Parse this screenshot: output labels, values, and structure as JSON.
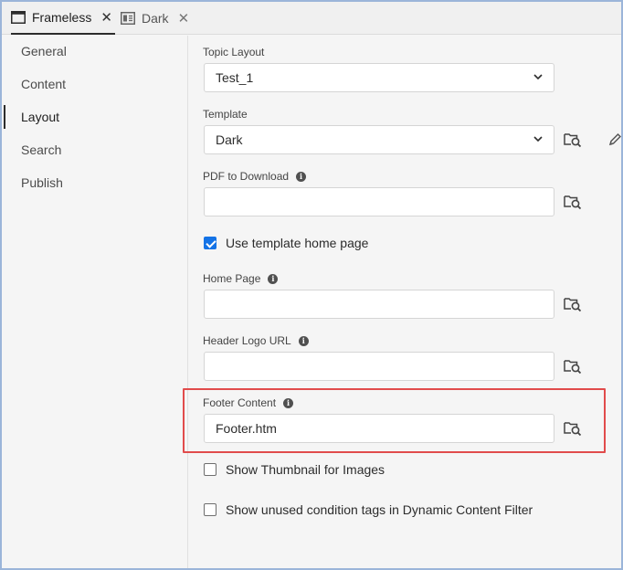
{
  "tabs": [
    {
      "label": "Frameless",
      "icon": "window-icon",
      "close": "✕"
    },
    {
      "label": "Dark",
      "icon": "layout-icon",
      "close": "✕"
    }
  ],
  "sidebar": {
    "items": [
      {
        "label": "General"
      },
      {
        "label": "Content"
      },
      {
        "label": "Layout"
      },
      {
        "label": "Search"
      },
      {
        "label": "Publish"
      }
    ],
    "selected": "Layout"
  },
  "form": {
    "topic_layout": {
      "label": "Topic Layout",
      "value": "Test_1"
    },
    "template": {
      "label": "Template",
      "value": "Dark"
    },
    "pdf_to_download": {
      "label": "PDF to Download",
      "value": ""
    },
    "use_template_home": {
      "label": "Use template home page",
      "checked": true
    },
    "home_page": {
      "label": "Home Page",
      "value": ""
    },
    "header_logo_url": {
      "label": "Header Logo URL",
      "value": ""
    },
    "footer_content": {
      "label": "Footer Content",
      "value": "Footer.htm"
    },
    "show_thumbnail": {
      "label": "Show Thumbnail for Images",
      "checked": false
    },
    "show_unused_tags": {
      "label": "Show unused condition tags in Dynamic Content Filter",
      "checked": false
    }
  },
  "colors": {
    "accent": "#1473e6",
    "highlight": "#e14b4b",
    "frame_border": "#9bb5d9"
  }
}
